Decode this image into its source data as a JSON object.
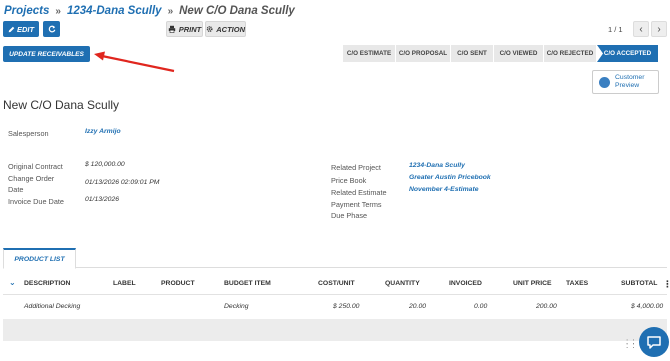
{
  "breadcrumb": {
    "projects": "Projects",
    "project": "1234-Dana Scully",
    "current": "New C/O Dana Scully",
    "separator": "»"
  },
  "toolbar": {
    "edit_label": "EDIT",
    "print_label": "PRINT",
    "action_label": "ACTION",
    "update_receivables_label": "UPDATE RECEIVABLES"
  },
  "pager": {
    "text": "1 / 1",
    "prev": "‹",
    "next": "›"
  },
  "status_steps": [
    {
      "label": "C/O ESTIMATE",
      "active": false
    },
    {
      "label": "C/O PROPOSAL",
      "active": false
    },
    {
      "label": "C/O SENT",
      "active": false
    },
    {
      "label": "C/O VIEWED",
      "active": false
    },
    {
      "label": "C/O REJECTED",
      "active": false
    },
    {
      "label": "C/O ACCEPTED",
      "active": true
    }
  ],
  "customer_preview": {
    "line1": "Customer",
    "line2": "Preview"
  },
  "record": {
    "title": "New C/O Dana Scully",
    "salesperson_label": "Salesperson",
    "salesperson": "Izzy Armijo",
    "original_contract_label": "Original Contract",
    "original_contract": "$ 120,000.00",
    "change_order_date_label_1": "Change Order",
    "change_order_date_label_2": "Date",
    "change_order_date": "01/13/2026 02:09:01 PM",
    "invoice_due_date_label": "Invoice Due Date",
    "invoice_due_date": "01/13/2026",
    "related_project_label": "Related Project",
    "related_project": "1234-Dana Scully",
    "price_book_label": "Price Book",
    "price_book": "Greater Austin Pricebook",
    "related_estimate_label": "Related Estimate",
    "related_estimate": "November 4-Estimate",
    "payment_terms_label": "Payment Terms",
    "due_phase_label": "Due Phase"
  },
  "tabs": {
    "product_list": "PRODUCT LIST"
  },
  "table": {
    "headers": {
      "description": "DESCRIPTION",
      "label": "LABEL",
      "product": "PRODUCT",
      "budget_item": "BUDGET ITEM",
      "cost_unit": "COST/UNIT",
      "quantity": "QUANTITY",
      "invoiced": "INVOICED",
      "unit_price": "UNIT PRICE",
      "taxes": "TAXES",
      "subtotal": "SUBTOTAL"
    },
    "rows": [
      {
        "description": "Additional Decking",
        "budget_item": "Decking",
        "cost_unit": "$ 250.00",
        "quantity": "20.00",
        "invoiced": "0.00",
        "unit_price": "200.00",
        "subtotal": "$ 4,000.00"
      }
    ]
  },
  "colors": {
    "accent": "#1f6fb2",
    "annotation_arrow": "#e0261e"
  }
}
